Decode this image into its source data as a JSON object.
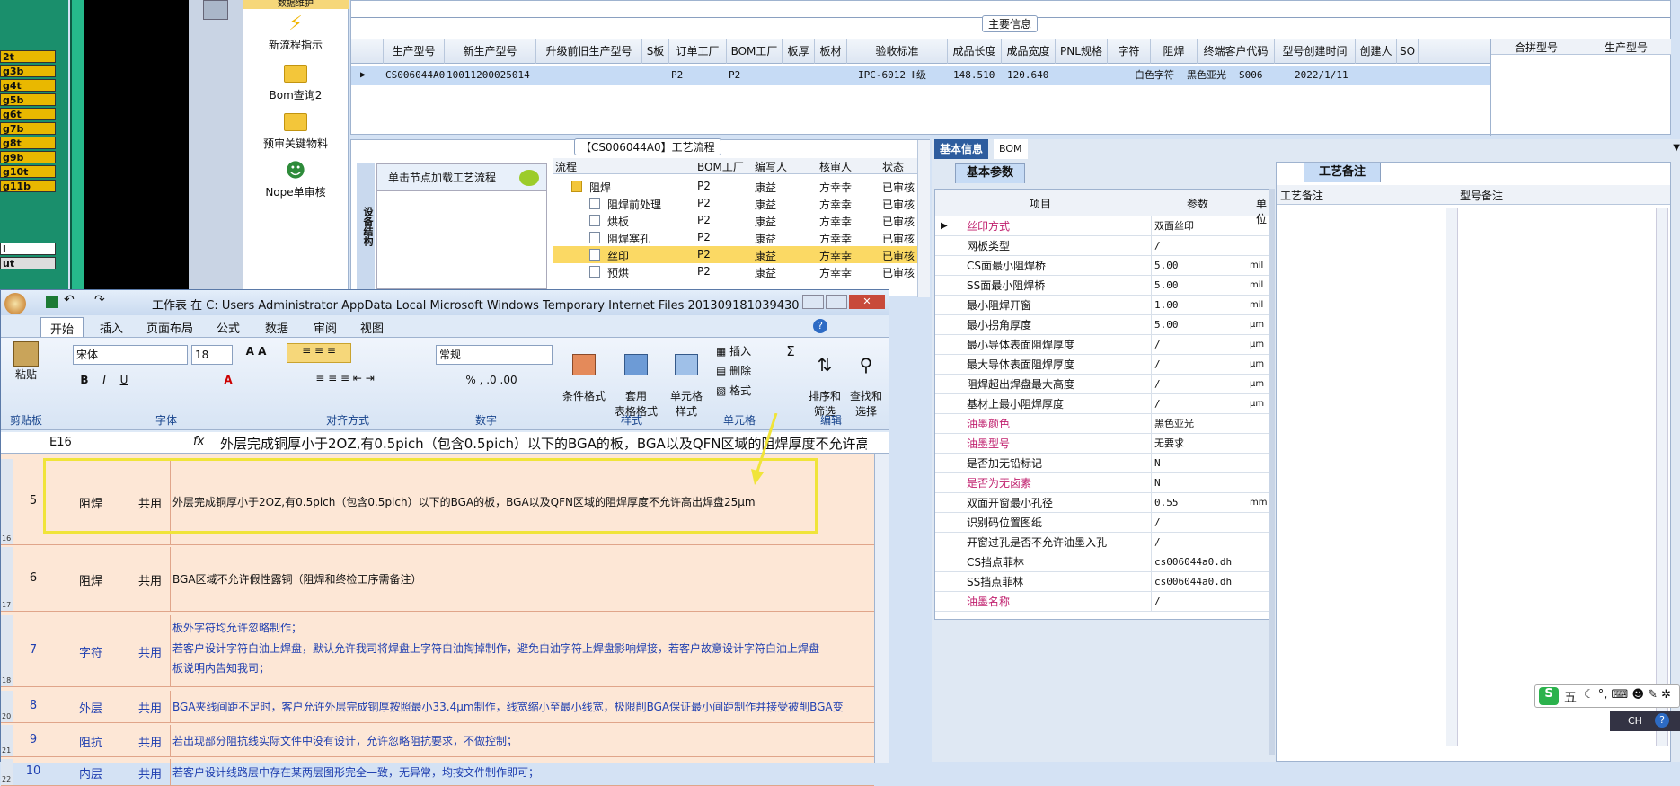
{
  "left_strip": [
    "2t",
    "g3b",
    "g4t",
    "g5b",
    "g6t",
    "g7b",
    "g8t",
    "g9b",
    "g10t",
    "g11b",
    "l",
    "ut"
  ],
  "quick_panel": {
    "top_item": "数据维护",
    "items": [
      "新流程指示",
      "Bom查询2",
      "预审关键物料",
      "Nope单审核"
    ]
  },
  "main_info": {
    "title": "主要信息",
    "columns": [
      "生产型号",
      "新生产型号",
      "升级前旧生产型号",
      "S板",
      "订单工厂",
      "BOM工厂",
      "板厚",
      "板材",
      "验收标准",
      "成品长度",
      "成品宽度",
      "PNL规格",
      "字符",
      "阻焊",
      "终端客户代码",
      "型号创建时间",
      "创建人",
      "SO"
    ],
    "side_columns": [
      "合拼型号",
      "生产型号"
    ],
    "row": [
      "CS006044A0",
      "10011200025014",
      "",
      "",
      "P2",
      "P2",
      "",
      "",
      "IPC-6012 Ⅱ级",
      "148.510",
      "120.640",
      "",
      "白色字符",
      "黑色亚光",
      "S006",
      "2022/1/11",
      "",
      ""
    ]
  },
  "process": {
    "title": "【CS006044A0】工艺流程",
    "side_tab": "设备结构",
    "hint": "单击节点加载工艺流程",
    "headers": [
      "流程",
      "BOM工厂",
      "编写人",
      "核审人",
      "状态"
    ],
    "rows": [
      {
        "name": "阻焊",
        "factory": "P2",
        "writer": "康益",
        "checker": "方幸幸",
        "status": "已审核"
      },
      {
        "name": "阻焊前处理",
        "factory": "P2",
        "writer": "康益",
        "checker": "方幸幸",
        "status": "已审核"
      },
      {
        "name": "烘板",
        "factory": "P2",
        "writer": "康益",
        "checker": "方幸幸",
        "status": "已审核"
      },
      {
        "name": "阻焊塞孔",
        "factory": "P2",
        "writer": "康益",
        "checker": "方幸幸",
        "status": "已审核"
      },
      {
        "name": "丝印",
        "factory": "P2",
        "writer": "康益",
        "checker": "方幸幸",
        "status": "已审核"
      },
      {
        "name": "预烘",
        "factory": "P2",
        "writer": "康益",
        "checker": "方幸幸",
        "status": "已审核"
      }
    ]
  },
  "basic": {
    "tabs": [
      "基本信息",
      "BOM"
    ],
    "sub_tab": "基本参数",
    "headers": [
      "项目",
      "参数",
      "单位"
    ],
    "params": [
      {
        "item": "丝印方式",
        "value": "双面丝印",
        "unit": "",
        "pink": true
      },
      {
        "item": "网板类型",
        "value": "/",
        "unit": "",
        "pink": false
      },
      {
        "item": "CS面最小阻焊桥",
        "value": "5.00",
        "unit": "mil",
        "pink": false
      },
      {
        "item": "SS面最小阻焊桥",
        "value": "5.00",
        "unit": "mil",
        "pink": false
      },
      {
        "item": "最小阻焊开窗",
        "value": "1.00",
        "unit": "mil",
        "pink": false
      },
      {
        "item": "最小拐角厚度",
        "value": "5.00",
        "unit": "μm",
        "pink": false
      },
      {
        "item": "最小导体表面阻焊厚度",
        "value": "/",
        "unit": "μm",
        "pink": false
      },
      {
        "item": "最大导体表面阻焊厚度",
        "value": "/",
        "unit": "μm",
        "pink": false
      },
      {
        "item": "阻焊超出焊盘最大高度",
        "value": "/",
        "unit": "μm",
        "pink": false
      },
      {
        "item": "基材上最小阻焊厚度",
        "value": "/",
        "unit": "μm",
        "pink": false
      },
      {
        "item": "油墨颜色",
        "value": "黑色亚光",
        "unit": "",
        "pink": true
      },
      {
        "item": "油墨型号",
        "value": "无要求",
        "unit": "",
        "pink": true
      },
      {
        "item": "是否加无铅标记",
        "value": "N",
        "unit": "",
        "pink": false
      },
      {
        "item": "是否为无卤素",
        "value": "N",
        "unit": "",
        "pink": true
      },
      {
        "item": "双面开窗最小孔径",
        "value": "0.55",
        "unit": "mm",
        "pink": false
      },
      {
        "item": "识别码位置图纸",
        "value": "/",
        "unit": "",
        "pink": false
      },
      {
        "item": "开窗过孔是否不允许油墨入孔",
        "value": "/",
        "unit": "",
        "pink": false
      },
      {
        "item": "CS挡点菲林",
        "value": "cs006044a0.dh",
        "unit": "",
        "pink": false
      },
      {
        "item": "SS挡点菲林",
        "value": "cs006044a0.dh",
        "unit": "",
        "pink": false
      },
      {
        "item": "油墨名称",
        "value": "/",
        "unit": "",
        "pink": true
      }
    ],
    "remark_tab": "工艺备注",
    "remark_headers": [
      "工艺备注",
      "型号备注"
    ]
  },
  "excel": {
    "title": "工作表 在 C: Users Administrator AppData Local Microsoft Windows Temporary Internet Files 201309181039430.doc  [...",
    "tabs": [
      "开始",
      "插入",
      "页面布局",
      "公式",
      "数据",
      "审阅",
      "视图"
    ],
    "font_name": "宋体",
    "font_size": "18",
    "number_format": "常规",
    "groups": [
      "剪贴板",
      "字体",
      "对齐方式",
      "数字",
      "样式",
      "单元格",
      "编辑"
    ],
    "buttons": {
      "paste": "粘贴",
      "cond_format": "条件格式",
      "table_format": "套用\n表格格式",
      "cell_style": "单元格\n样式",
      "insert": "插入",
      "delete": "删除",
      "format": "格式",
      "sort": "排序和\n筛选",
      "find": "查找和\n选择"
    },
    "cell_ref": "E16",
    "fx": "fx",
    "formula": "外层完成铜厚小于2OZ,有0.5pich（包含0.5pich）以下的BGA的板，BGA以及QFN区域的阻焊厚度不允许高",
    "rows": [
      {
        "rownum": "16",
        "no": "5",
        "cat": "阻焊",
        "scope": "共用",
        "text": [
          "外层完成铜厚小于2OZ,有0.5pich（包含0.5pich）以下的BGA的板，BGA以及QFN区域的阻焊厚度不允许高出焊盘25μm"
        ],
        "blue": false
      },
      {
        "rownum": "17",
        "no": "6",
        "cat": "阻焊",
        "scope": "共用",
        "text": [
          "BGA区域不允许假性露铜（阻焊和终检工序需备注）"
        ],
        "blue": false
      },
      {
        "rownum": "18",
        "no": "7",
        "cat": "字符",
        "scope": "共用",
        "text": [
          "板外字符均允许忽略制作；",
          "若客户设计字符白油上焊盘，默认允许我司将焊盘上字符白油掏掉制作，避免白油字符上焊盘影响焊接，若客户故意设计字符白油上焊盘",
          "板说明内告知我司；"
        ],
        "blue": true
      },
      {
        "rownum": "20",
        "no": "8",
        "cat": "外层",
        "scope": "共用",
        "text": [
          "BGA夹线间距不足时，客户允许外层完成铜厚按照最小33.4μm制作，线宽缩小至最小线宽，极限削BGA保证最小间距制作并接受被削BGA变"
        ],
        "blue": true
      },
      {
        "rownum": "21",
        "no": "9",
        "cat": "阻抗",
        "scope": "共用",
        "text": [
          "若出现部分阻抗线实际文件中没有设计，允许忽略阻抗要求，不做控制；"
        ],
        "blue": true
      },
      {
        "rownum": "22",
        "no": "10",
        "cat": "内层",
        "scope": "共用",
        "text": [
          "若客户设计线路层中存在某两层图形完全一致，无异常，均按文件制作即可；"
        ],
        "blue": true
      }
    ]
  },
  "ime": {
    "label": "五",
    "lang": "CH"
  },
  "colors": {
    "accent": "#1f5fa8",
    "selected": "#c6dbf5",
    "highlight": "#fbd964",
    "pink": "#c0206e",
    "sheet": "#fde7d6"
  }
}
